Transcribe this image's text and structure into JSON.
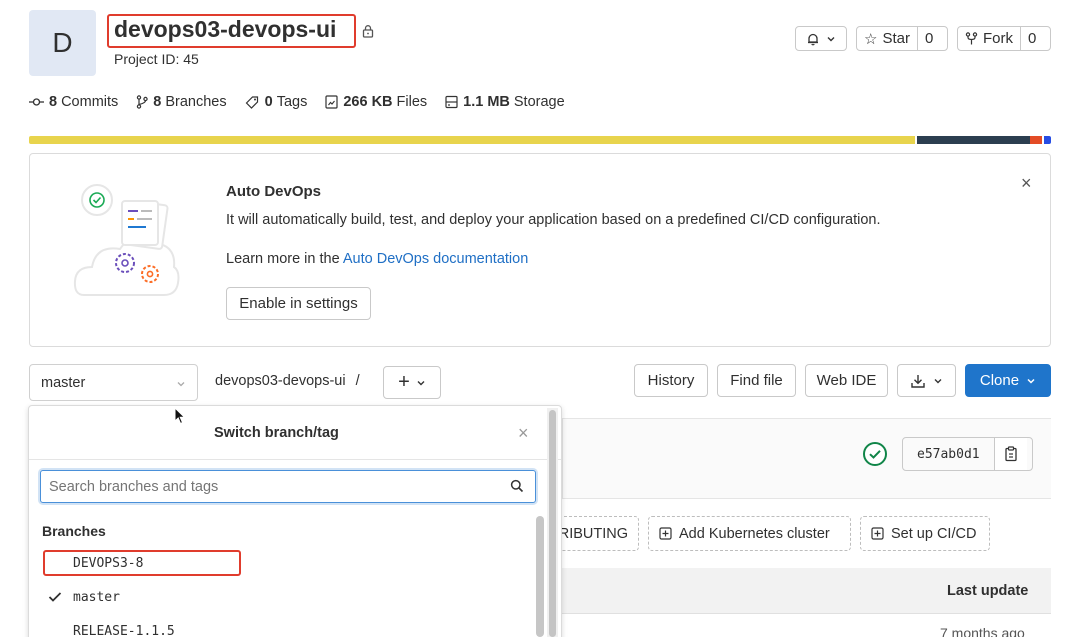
{
  "project": {
    "avatar_letter": "D",
    "name": "devops03-devops-ui",
    "id_label": "Project ID: 45"
  },
  "actions": {
    "notify_chevron": "⌄",
    "star_label": "Star",
    "star_count": "0",
    "fork_label": "Fork",
    "fork_count": "0"
  },
  "stats": [
    {
      "value": "8",
      "label": "Commits",
      "icon": "commit-icon"
    },
    {
      "value": "8",
      "label": "Branches",
      "icon": "branch-icon"
    },
    {
      "value": "0",
      "label": "Tags",
      "icon": "tag-icon"
    },
    {
      "value": "266 KB",
      "label": "Files",
      "icon": "file-icon"
    },
    {
      "value": "1.1 MB",
      "label": "Storage",
      "icon": "storage-icon"
    }
  ],
  "language_bar": [
    {
      "color": "#e8d44d",
      "share": 0.867
    },
    {
      "color": "#ffffff",
      "share": 0.002
    },
    {
      "color": "#2c3e50",
      "share": 0.11
    },
    {
      "color": "#e34c26",
      "share": 0.012
    },
    {
      "color": "#ffffff",
      "share": 0.002
    },
    {
      "color": "#264de4",
      "share": 0.007
    }
  ],
  "auto_devops": {
    "title": "Auto DevOps",
    "description": "It will automatically build, test, and deploy your application based on a predefined CI/CD configuration.",
    "learn_prefix": "Learn more in the ",
    "learn_link": "Auto DevOps documentation",
    "enable_button": "Enable in settings",
    "close": "×"
  },
  "toolbar": {
    "branch": "master",
    "path": "devops03-devops-ui",
    "path_sep": "/",
    "add_label": "+",
    "history": "History",
    "find_file": "Find file",
    "web_ide": "Web IDE",
    "clone": "Clone"
  },
  "commit": {
    "sha": "e57ab0d1"
  },
  "shortcuts": {
    "contributing": "RIBUTING",
    "kubernetes": "Add Kubernetes cluster",
    "cicd": "Set up CI/CD"
  },
  "table": {
    "last_update_header": "Last update",
    "first_row_update": "7 months ago"
  },
  "dropdown": {
    "title": "Switch branch/tag",
    "close": "×",
    "search_placeholder": "Search branches and tags",
    "section_label": "Branches",
    "branches": [
      {
        "name": "DEVOPS3-8",
        "selected": false
      },
      {
        "name": "master",
        "selected": true
      },
      {
        "name": "RELEASE-1.1.5",
        "selected": false
      }
    ]
  },
  "colors": {
    "accent_blue": "#1f75cb",
    "annotation_red": "#e03c2d",
    "success_green": "#108548"
  }
}
